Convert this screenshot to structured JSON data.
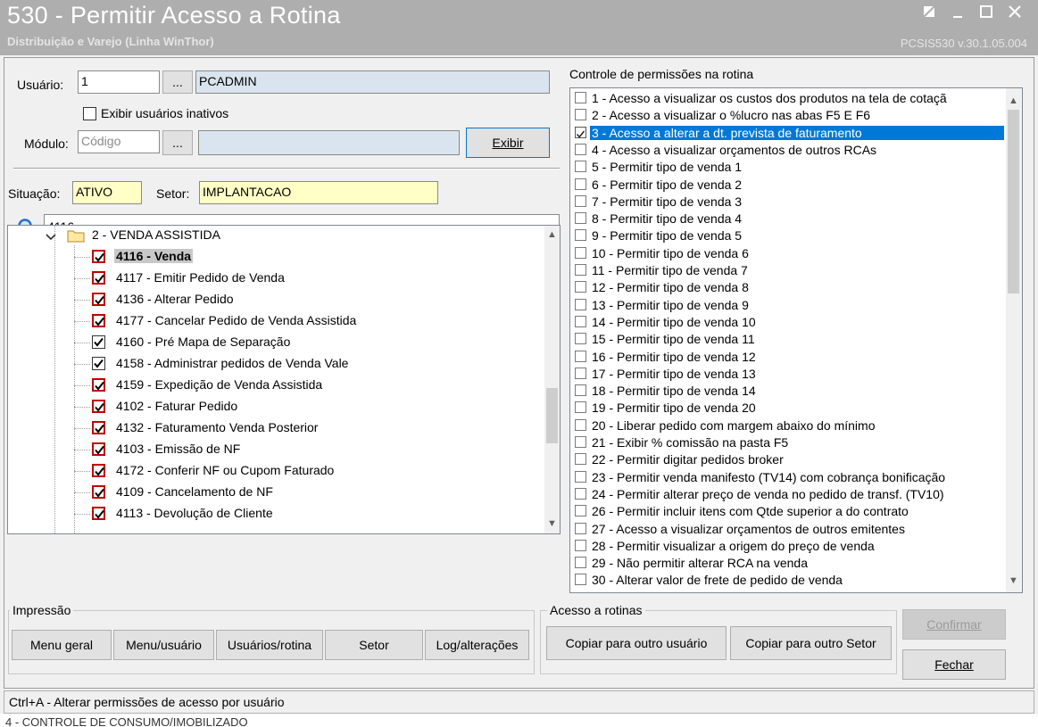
{
  "window": {
    "title": "530 - Permitir Acesso a Rotina",
    "subtitle": "Distribuição e Varejo (Linha WinThor)",
    "version": "PCSIS530  v.30.1.05.004"
  },
  "form": {
    "usuario_label": "Usuário:",
    "usuario_code": "1",
    "usuario_lookup": "...",
    "usuario_name": "PCADMIN",
    "inativos_label": "Exibir usuários inativos",
    "modulo_label": "Módulo:",
    "modulo_placeholder": "Código",
    "modulo_lookup": "...",
    "exibir_button": "Exibir",
    "situacao_label": "Situação:",
    "situacao_value": "ATIVO",
    "setor_label": "Setor:",
    "setor_value": "IMPLANTACAO",
    "search_value": "4116"
  },
  "tree": {
    "folder_label": "2 - VENDA ASSISTIDA",
    "items": [
      {
        "label": "4116 - Venda",
        "selected": true
      },
      {
        "label": "4117 - Emitir Pedido de Venda"
      },
      {
        "label": "4136 - Alterar Pedido"
      },
      {
        "label": "4177 - Cancelar Pedido de Venda Assistida"
      },
      {
        "label": "4160 - Pré Mapa de Separação"
      },
      {
        "label": "4158 - Administrar pedidos de Venda Vale"
      },
      {
        "label": "4159 - Expedição de Venda Assistida"
      },
      {
        "label": "4102 - Faturar Pedido"
      },
      {
        "label": "4132 - Faturamento Venda Posterior"
      },
      {
        "label": "4103 - Emissão de NF"
      },
      {
        "label": "4172 - Conferir NF ou Cupom Faturado"
      },
      {
        "label": "4109 - Cancelamento de NF"
      },
      {
        "label": "4113 - Devolução de Cliente"
      }
    ]
  },
  "permissions": {
    "title": "Controle de permissões na rotina",
    "items": [
      {
        "label": "1 - Acesso a visualizar os custos dos produtos na tela de cotaçã",
        "checked": false
      },
      {
        "label": "2 - Acesso a visualizar o %lucro nas abas F5 E F6",
        "checked": false
      },
      {
        "label": "3 - Acesso a alterar a dt. prevista de faturamento",
        "checked": true,
        "selected": true
      },
      {
        "label": "4 - Acesso a visualizar orçamentos de outros RCAs",
        "checked": false
      },
      {
        "label": "5 - Permitir tipo de venda 1",
        "checked": false
      },
      {
        "label": "6 - Permitir tipo de venda 2",
        "checked": false
      },
      {
        "label": "7 - Permitir tipo de venda 3",
        "checked": false
      },
      {
        "label": "8 - Permitir tipo de venda 4",
        "checked": false
      },
      {
        "label": "9 - Permitir tipo de venda 5",
        "checked": false
      },
      {
        "label": "10 - Permitir tipo de venda 6",
        "checked": false
      },
      {
        "label": "11 - Permitir tipo de venda 7",
        "checked": false
      },
      {
        "label": "12 - Permitir tipo de venda 8",
        "checked": false
      },
      {
        "label": "13 - Permitir tipo de venda 9",
        "checked": false
      },
      {
        "label": "14 - Permitir tipo de venda 10",
        "checked": false
      },
      {
        "label": "15 - Permitir tipo de venda 11",
        "checked": false
      },
      {
        "label": "16 - Permitir tipo de venda 12",
        "checked": false
      },
      {
        "label": "17 - Permitir tipo de venda 13",
        "checked": false
      },
      {
        "label": "18 - Permitir tipo de venda 14",
        "checked": false
      },
      {
        "label": "19 - Permitir tipo de venda 20",
        "checked": false
      },
      {
        "label": "20 - Liberar pedido com margem abaixo do mínimo",
        "checked": false
      },
      {
        "label": "21 - Exibir % comissão na pasta F5",
        "checked": false
      },
      {
        "label": "22 - Permitir digitar pedidos broker",
        "checked": false
      },
      {
        "label": "23 - Permitir venda manifesto (TV14) com cobrança bonificação",
        "checked": false
      },
      {
        "label": "24 - Permitir alterar preço de venda no pedido de transf. (TV10)",
        "checked": false
      },
      {
        "label": "26 - Permitir incluir itens com Qtde superior a do contrato",
        "checked": false
      },
      {
        "label": "27 - Acesso a visualizar orçamentos de outros emitentes",
        "checked": false
      },
      {
        "label": "28 - Permitir visualizar a origem do preço de venda",
        "checked": false
      },
      {
        "label": "29 - Não permitir alterar RCA na venda",
        "checked": false
      },
      {
        "label": "30 - Alterar valor de frete de pedido de venda",
        "checked": false
      }
    ]
  },
  "impressao": {
    "title": "Impressão",
    "menu_geral": "Menu geral",
    "menu_usuario": "Menu/usuário",
    "usuarios_rotina": "Usuários/rotina",
    "setor": "Setor",
    "log_alteracoes": "Log/alterações"
  },
  "acesso": {
    "title": "Acesso a rotinas",
    "copiar_usuario": "Copiar para outro usuário",
    "copiar_setor": "Copiar para outro Setor"
  },
  "actions": {
    "confirmar": "Confirmar",
    "fechar": "Fechar"
  },
  "status": {
    "text": "Ctrl+A - Alterar permissões de acesso por usuário"
  },
  "background": {
    "text": "4 - CONTROLE DE CONSUMO/IMOBILIZADO"
  }
}
